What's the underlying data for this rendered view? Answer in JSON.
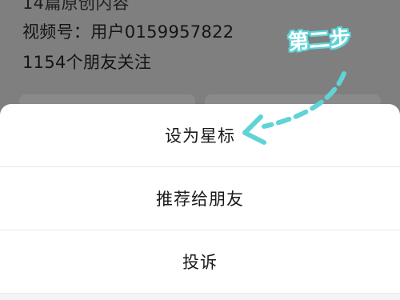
{
  "profile": {
    "line0": "14篇原创内容",
    "video_account": "视频号：用户0159957822",
    "followers": "1154个朋友关注"
  },
  "annotation": {
    "step_label": "第二步",
    "color": "#5fd3d6"
  },
  "action_sheet": {
    "items": [
      {
        "label": "设为星标"
      },
      {
        "label": "推荐给朋友"
      },
      {
        "label": "投诉"
      }
    ]
  },
  "colors": {
    "overlay": "#7f7f7f",
    "sheet_bg": "#ffffff",
    "text": "#1a1a1a",
    "divider": "#e9e9e9"
  }
}
